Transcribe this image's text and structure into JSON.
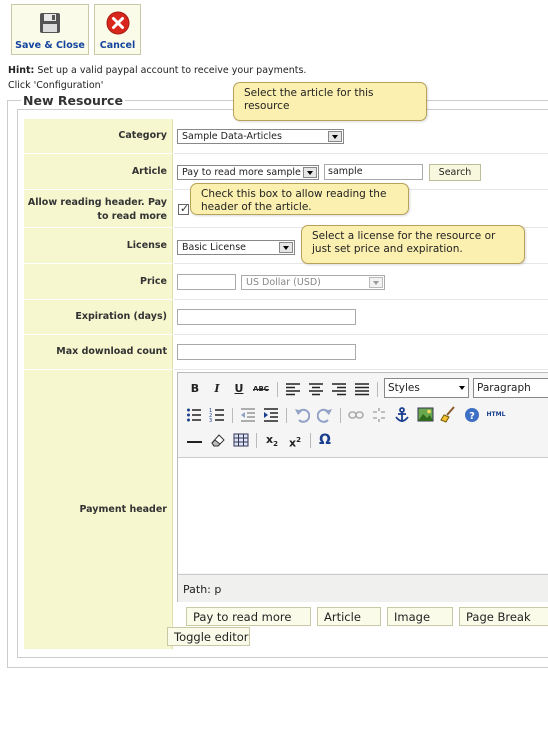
{
  "toolbar": {
    "save_label": "Save & Close",
    "cancel_label": "Cancel"
  },
  "hint": {
    "prefix": "Hint:",
    "text": " Set up a valid paypal account to receive your payments.",
    "line2": "Click 'Configuration'"
  },
  "form": {
    "legend": "New Resource",
    "category": {
      "label": "Category",
      "value": "Sample Data-Articles"
    },
    "article": {
      "label": "Article",
      "value": "Pay to read more sample",
      "search_value": "sample",
      "search_button": "Search"
    },
    "allow_header": {
      "label": "Allow reading header. Pay to read more",
      "checked": true
    },
    "license": {
      "label": "License",
      "value": "Basic License"
    },
    "price": {
      "label": "Price",
      "value": "",
      "currency": "US Dollar (USD)"
    },
    "expiration": {
      "label": "Expiration (days)",
      "value": ""
    },
    "max_download": {
      "label": "Max download count",
      "value": ""
    },
    "payment_header": {
      "label": "Payment header"
    }
  },
  "tooltips": {
    "article": "Select the article for this resource",
    "checkbox": "Check this box to allow reading the header of the article.",
    "license": "Select a license for the resource or just set price and expiration."
  },
  "editor": {
    "styles": "Styles",
    "format": "Paragraph",
    "path": "Path: p",
    "buttons": [
      "Pay to read more",
      "Article",
      "Image",
      "Page Break"
    ],
    "toggle": "Toggle editor",
    "tool_labels": {
      "bold": "B",
      "italic": "I",
      "underline": "U",
      "strike": "ABC",
      "html": "HTML",
      "omega": "Ω"
    }
  }
}
